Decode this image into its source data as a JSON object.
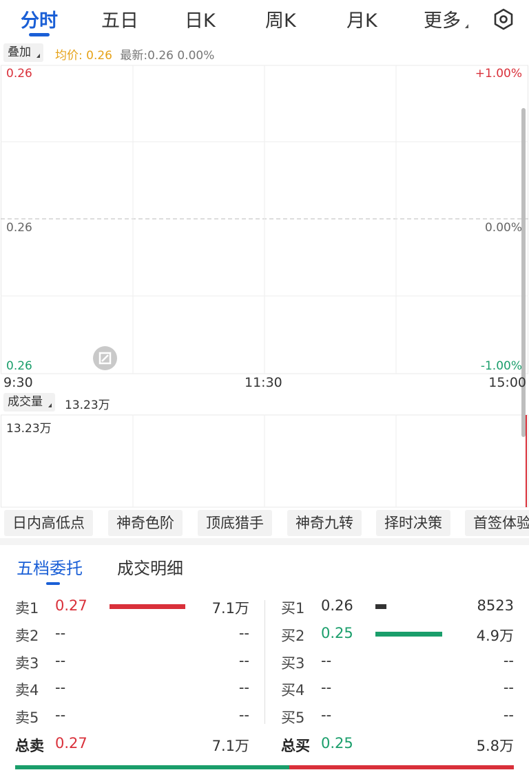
{
  "tabs": {
    "items": [
      "分时",
      "五日",
      "日K",
      "周K",
      "月K",
      "更多"
    ],
    "active_index": 0
  },
  "infobar": {
    "overlay_label": "叠加",
    "avg_label": "均价:",
    "avg_value": "0.26",
    "latest_text": "最新:0.26 0.00%"
  },
  "chart": {
    "price_top": "0.26",
    "price_mid": "0.26",
    "price_bottom": "0.26",
    "pct_top": "+1.00%",
    "pct_mid": "0.00%",
    "pct_bottom": "-1.00%",
    "time_start": "9:30",
    "time_mid": "11:30",
    "time_end": "15:00"
  },
  "volume": {
    "label": "成交量",
    "value": "13.23万",
    "axis_max": "13.23万",
    "bar_fraction": 1.0
  },
  "indicators": [
    "日内高低点",
    "神奇色阶",
    "顶底猎手",
    "神奇九转",
    "择时决策",
    "首签体验"
  ],
  "book_tabs": {
    "items": [
      "五档委托",
      "成交明细"
    ],
    "active_index": 0
  },
  "order_book": {
    "sell": [
      {
        "label": "卖1",
        "price": "0.27",
        "volume": "7.1万",
        "bar_fraction": 1.0
      },
      {
        "label": "卖2",
        "price": "--",
        "volume": "--",
        "bar_fraction": 0
      },
      {
        "label": "卖3",
        "price": "--",
        "volume": "--",
        "bar_fraction": 0
      },
      {
        "label": "卖4",
        "price": "--",
        "volume": "--",
        "bar_fraction": 0
      },
      {
        "label": "卖5",
        "price": "--",
        "volume": "--",
        "bar_fraction": 0
      }
    ],
    "buy": [
      {
        "label": "买1",
        "price": "0.26",
        "volume": "8523",
        "bar_fraction": 0.17
      },
      {
        "label": "买2",
        "price": "0.25",
        "volume": "4.9万",
        "bar_fraction": 1.0
      },
      {
        "label": "买3",
        "price": "--",
        "volume": "--",
        "bar_fraction": 0
      },
      {
        "label": "买4",
        "price": "--",
        "volume": "--",
        "bar_fraction": 0
      },
      {
        "label": "买5",
        "price": "--",
        "volume": "--",
        "bar_fraction": 0
      }
    ],
    "total_sell": {
      "label": "总卖",
      "price": "0.27",
      "volume": "7.1万"
    },
    "total_buy": {
      "label": "总买",
      "price": "0.25",
      "volume": "5.8万"
    },
    "buy_ratio": 0.55
  },
  "colors": {
    "accent": "#1a5fd6",
    "up": "#d9303a",
    "down": "#1a9e6b",
    "avg": "#e6a218",
    "sell1_bar": "#d9303a",
    "buy1_bar": "#333333",
    "buy2_bar": "#1a9e6b"
  }
}
